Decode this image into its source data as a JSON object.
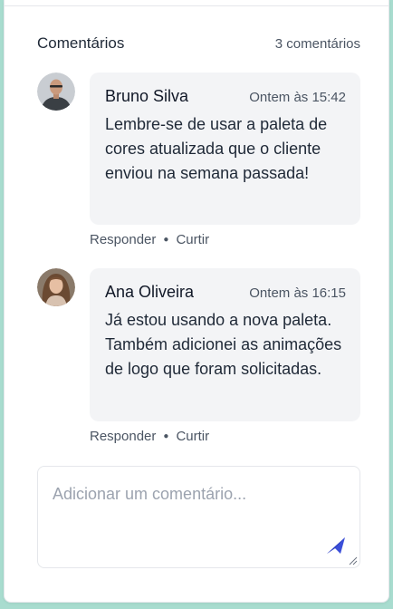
{
  "header": {
    "title": "Comentários",
    "count": "3 comentários"
  },
  "comments": [
    {
      "author": "Bruno Silva",
      "time": "Ontem às 15:42",
      "text": "Lembre-se de usar a paleta de cores atualizada que o cliente enviou na semana passada!",
      "reply_label": "Responder",
      "like_label": "Curtir"
    },
    {
      "author": "Ana Oliveira",
      "time": "Ontem às 16:15",
      "text": "Já estou usando a nova paleta. Também adicionei as animações de logo que foram solicitadas.",
      "reply_label": "Responder",
      "like_label": "Curtir"
    }
  ],
  "compose": {
    "placeholder": "Adicionar um comentário...",
    "send_icon": "send-icon",
    "accent_color": "#3b4fd9"
  }
}
